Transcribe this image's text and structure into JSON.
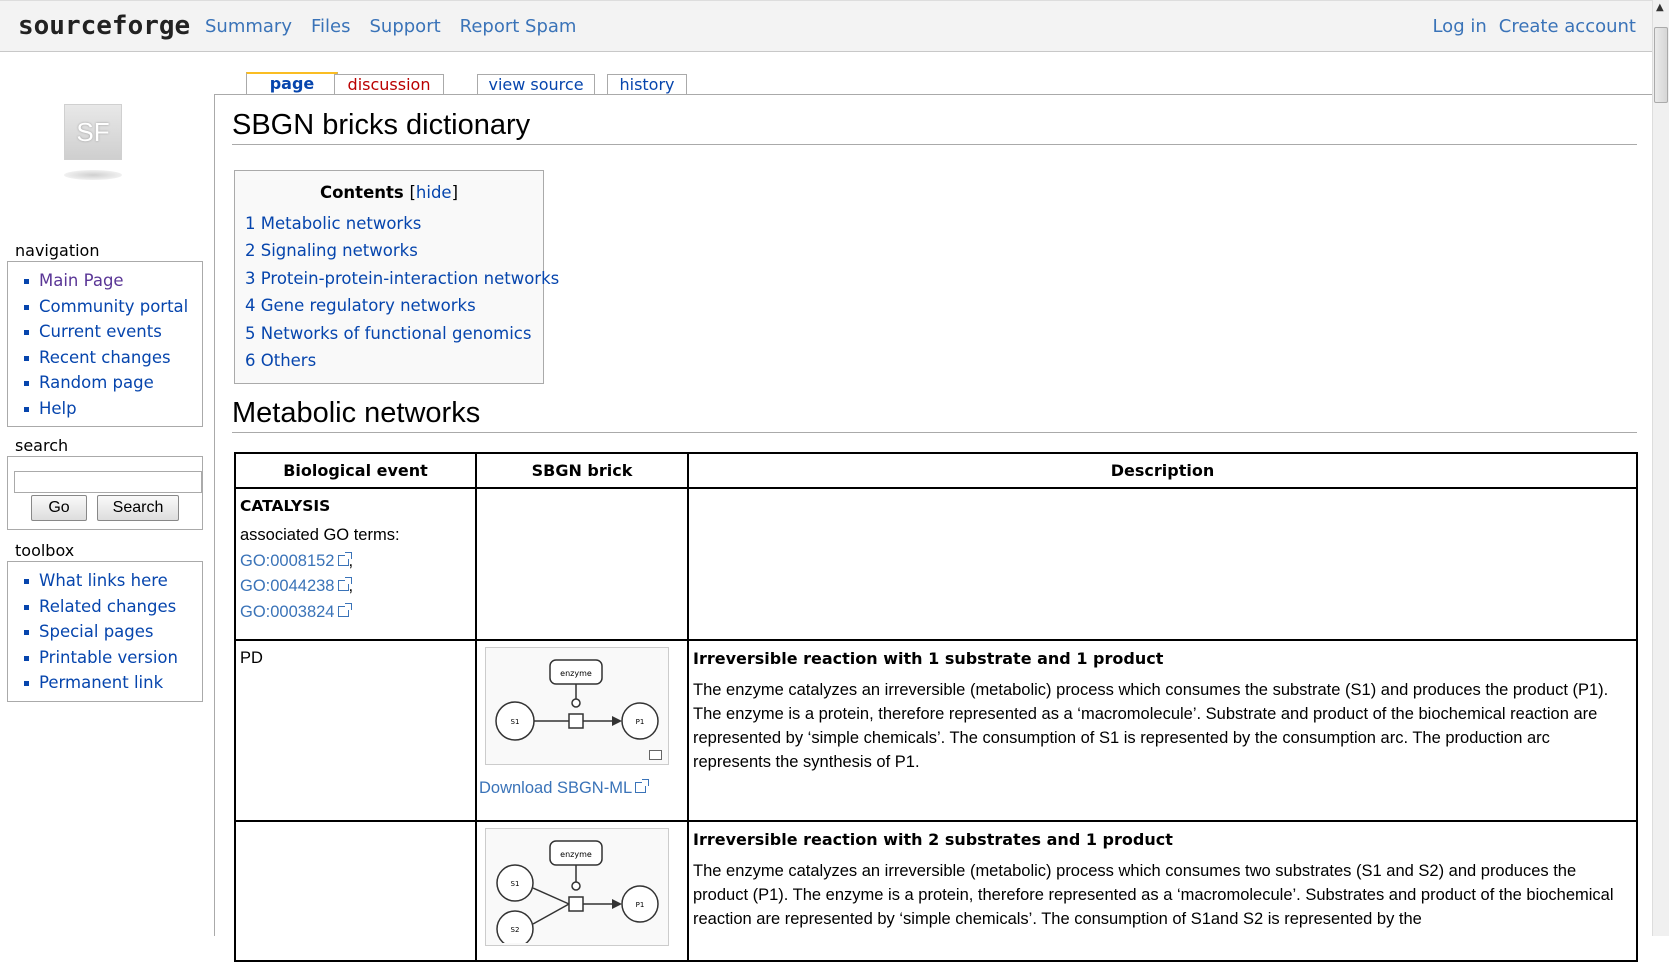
{
  "topbar": {
    "logo": "sourceforge",
    "nav": [
      "Summary",
      "Files",
      "Support",
      "Report Spam"
    ],
    "login": "Log in",
    "create_account": "Create account"
  },
  "sidebar": {
    "logo_text": "SF",
    "navigation_title": "navigation",
    "navigation": [
      "Main Page",
      "Community portal",
      "Current events",
      "Recent changes",
      "Random page",
      "Help"
    ],
    "search_title": "search",
    "search_value": "",
    "go_label": "Go",
    "search_label": "Search",
    "toolbox_title": "toolbox",
    "toolbox": [
      "What links here",
      "Related changes",
      "Special pages",
      "Printable version",
      "Permanent link"
    ]
  },
  "tabs": {
    "page": "page",
    "discussion": "discussion",
    "view_source": "view source",
    "history": "history"
  },
  "page": {
    "title": "SBGN bricks dictionary",
    "toc_title": "Contents",
    "toc_hide": "hide",
    "toc": [
      "1 Metabolic networks",
      "2 Signaling networks",
      "3 Protein-protein-interaction networks",
      "4 Gene regulatory networks",
      "5 Networks of functional genomics",
      "6 Others"
    ],
    "section1": "Metabolic networks"
  },
  "table": {
    "headers": [
      "Biological event",
      "SBGN brick",
      "Description"
    ],
    "row1": {
      "event": "CATALYSIS",
      "assoc": "associated GO terms:",
      "go_terms": [
        "GO:0008152",
        "GO:0044238",
        "GO:0003824"
      ]
    },
    "row2": {
      "event": "PD",
      "download": "Download SBGN-ML",
      "desc_title": "Irreversible reaction with 1 substrate and 1 product",
      "desc_text": "The enzyme catalyzes an irreversible (metabolic) process which consumes the substrate (S1) and produces the product (P1). The enzyme is a protein, therefore represented as a ‘macromolecule’. Substrate and product of the biochemical reaction are represented by ‘simple chemicals’. The consumption of S1 is represented by the consumption arc. The production arc represents the synthesis of P1."
    },
    "row3": {
      "desc_title": "Irreversible reaction with 2 substrates and 1 product",
      "desc_text": "The enzyme catalyzes an irreversible (metabolic) process which consumes two substrates (S1 and S2) and produces the product (P1). The enzyme is a protein, therefore represented as a ‘macromolecule’. Substrates and product of the biochemical reaction are represented by ‘simple chemicals’. The consumption of S1and S2 is represented by the"
    },
    "diagram_labels": {
      "enzyme": "enzyme",
      "s1": "S1",
      "s2": "S2",
      "p1": "P1"
    }
  }
}
